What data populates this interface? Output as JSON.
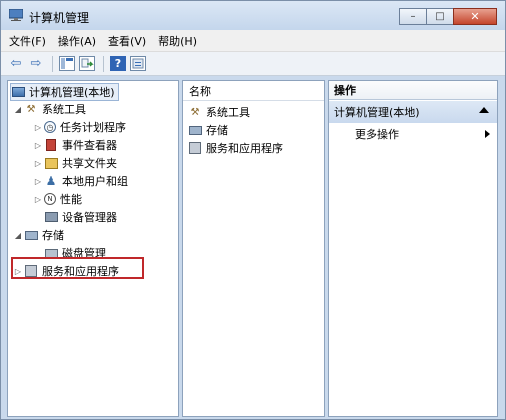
{
  "window": {
    "title": "计算机管理",
    "buttons": {
      "minimize": "–",
      "maximize": "□",
      "close": "✕"
    }
  },
  "menu": [
    "文件(F)",
    "操作(A)",
    "查看(V)",
    "帮助(H)"
  ],
  "toolbar": {
    "icons": [
      "back-arrow-icon",
      "forward-arrow-icon",
      "show-hide-tree-icon",
      "export-list-icon",
      "help-icon",
      "properties-icon"
    ],
    "back": "⇦",
    "forward": "⇨",
    "help": "?"
  },
  "tree": {
    "root": "计算机管理(本地)",
    "items": [
      {
        "label": "系统工具",
        "icon": "tools-icon",
        "expander": "◢"
      },
      {
        "label": "任务计划程序",
        "icon": "clock-icon",
        "expander": "▷"
      },
      {
        "label": "事件查看器",
        "icon": "event-viewer-icon",
        "expander": "▷"
      },
      {
        "label": "共享文件夹",
        "icon": "shared-folder-icon",
        "expander": "▷"
      },
      {
        "label": "本地用户和组",
        "icon": "users-icon",
        "expander": "▷"
      },
      {
        "label": "性能",
        "icon": "performance-icon",
        "expander": "▷"
      },
      {
        "label": "设备管理器",
        "icon": "device-manager-icon",
        "expander": ""
      },
      {
        "label": "存储",
        "icon": "storage-icon",
        "expander": "◢"
      },
      {
        "label": "磁盘管理",
        "icon": "disk-icon",
        "expander": ""
      },
      {
        "label": "服务和应用程序",
        "icon": "services-icon",
        "expander": "▷"
      }
    ]
  },
  "middle": {
    "header": "名称",
    "items": [
      "系统工具",
      "存储",
      "服务和应用程序"
    ]
  },
  "actions": {
    "header": "操作",
    "section": "计算机管理(本地)",
    "item": "更多操作"
  },
  "colors": {
    "highlight_box": "#c0282a",
    "titlebar": "#c4d6ec"
  }
}
